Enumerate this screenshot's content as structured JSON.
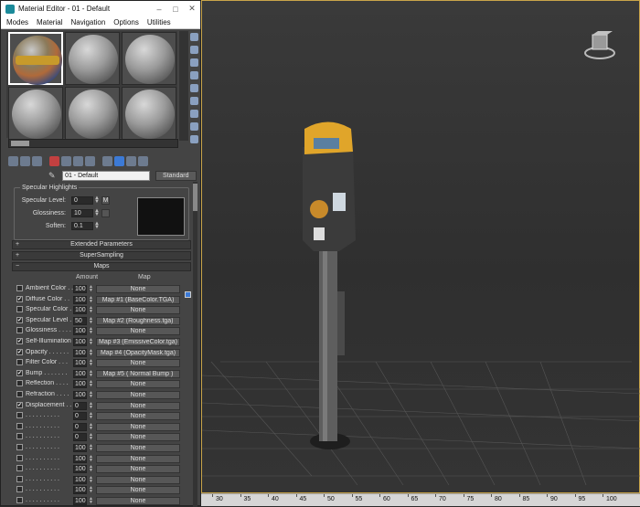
{
  "window": {
    "title": "Material Editor - 01 - Default"
  },
  "menu": [
    "Modes",
    "Material",
    "Navigation",
    "Options",
    "Utilities"
  ],
  "material": {
    "name": "01 - Default",
    "type": "Standard"
  },
  "specular": {
    "group_title": "Specular Highlights",
    "specular_level_label": "Specular Level:",
    "specular_level": "0",
    "m_button": "M",
    "glossiness_label": "Glossiness:",
    "glossiness": "10",
    "soften_label": "Soften:",
    "soften": "0.1"
  },
  "rollouts": {
    "extended": "Extended Parameters",
    "supersampling": "SuperSampling",
    "maps": "Maps"
  },
  "maps_header": {
    "amount": "Amount",
    "map": "Map"
  },
  "maps": [
    {
      "label": "Ambient Color . .",
      "checked": false,
      "amount": "100",
      "map": "None"
    },
    {
      "label": "Diffuse Color . .",
      "checked": true,
      "amount": "100",
      "map": "Map #1 (BaseColor.TGA)"
    },
    {
      "label": "Specular Color . .",
      "checked": false,
      "amount": "100",
      "map": "None"
    },
    {
      "label": "Specular Level . .",
      "checked": true,
      "amount": "50",
      "map": "Map #2 (Roughness.tga)"
    },
    {
      "label": "Glossiness . . . .",
      "checked": false,
      "amount": "100",
      "map": "None"
    },
    {
      "label": "Self-Illumination .",
      "checked": true,
      "amount": "100",
      "map": "Map #3 (EmissiveColor.tga)"
    },
    {
      "label": "Opacity . . . . . .",
      "checked": true,
      "amount": "100",
      "map": "Map #4 (OpacityMask.tga)"
    },
    {
      "label": "Filter Color . . .",
      "checked": false,
      "amount": "100",
      "map": "None"
    },
    {
      "label": "Bump . . . . . . .",
      "checked": true,
      "amount": "100",
      "map": "Map #5 ( Normal Bump )"
    },
    {
      "label": "Reflection . . . .",
      "checked": false,
      "amount": "100",
      "map": "None"
    },
    {
      "label": "Refraction . . . .",
      "checked": false,
      "amount": "100",
      "map": "None"
    },
    {
      "label": "Displacement . . .",
      "checked": true,
      "amount": "0",
      "map": "None"
    },
    {
      "label": ". . . . . . . . . .",
      "checked": false,
      "amount": "0",
      "map": "None"
    },
    {
      "label": ". . . . . . . . . .",
      "checked": false,
      "amount": "0",
      "map": "None"
    },
    {
      "label": ". . . . . . . . . .",
      "checked": false,
      "amount": "0",
      "map": "None"
    },
    {
      "label": ". . . . . . . . . .",
      "checked": false,
      "amount": "100",
      "map": "None"
    },
    {
      "label": ". . . . . . . . . .",
      "checked": false,
      "amount": "100",
      "map": "None"
    },
    {
      "label": ". . . . . . . . . .",
      "checked": false,
      "amount": "100",
      "map": "None"
    },
    {
      "label": ". . . . . . . . . .",
      "checked": false,
      "amount": "100",
      "map": "None"
    },
    {
      "label": ". . . . . . . . . .",
      "checked": false,
      "amount": "100",
      "map": "None"
    },
    {
      "label": ". . . . . . . . . .",
      "checked": false,
      "amount": "100",
      "map": "None"
    }
  ],
  "ruler": [
    "30",
    "35",
    "40",
    "45",
    "50",
    "55",
    "60",
    "65",
    "70",
    "75",
    "80",
    "85",
    "90",
    "95",
    "100"
  ],
  "colors": {
    "viewport_border": "#c9a54a",
    "meter_head": "#e0a52a"
  }
}
